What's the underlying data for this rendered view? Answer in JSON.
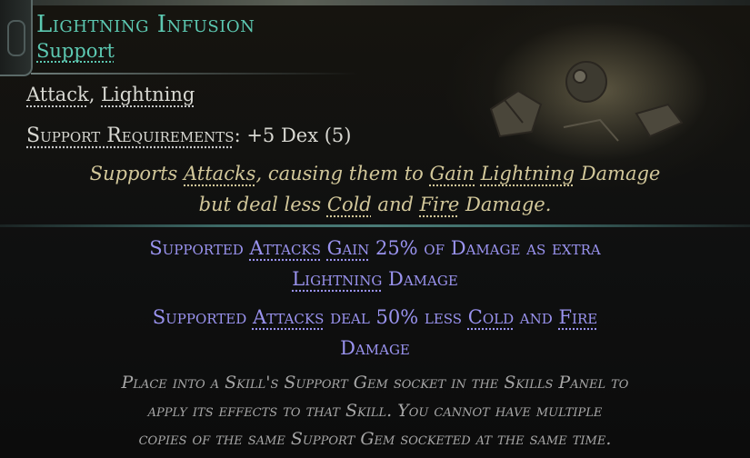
{
  "gem": {
    "name": "Lightning Infusion",
    "type": "Support",
    "tags": {
      "attack": "Attack",
      "sep": ", ",
      "lightning": "Lightning"
    },
    "requirements": {
      "label": "Support Requirements",
      "colon": ":",
      "value": "+5 Dex (5)"
    },
    "description": {
      "line1": {
        "t1": "Supports ",
        "attacks": "Attacks",
        "t2": ", causing them to ",
        "gain": "Gain",
        "t3": " ",
        "lightning": "Lightning",
        "t4": " Damage"
      },
      "line2": {
        "t1": "but deal less ",
        "cold": "Cold",
        "t2": " and ",
        "fire": "Fire",
        "t3": " Damage."
      }
    },
    "modifiers": {
      "mod1": {
        "t1": "Supported ",
        "attacks": "Attacks",
        "t2": " ",
        "gain": "Gain",
        "t3": " 25% of Damage as extra",
        "lightning": "Lightning",
        "t4": " Damage"
      },
      "mod2": {
        "t1": "Supported ",
        "attacks": "Attacks",
        "t2": " deal 50% less ",
        "cold": "Cold",
        "t3": " and ",
        "fire": "Fire",
        "t4": "Damage"
      }
    },
    "flavour": {
      "line1": "Place into a Skill's Support Gem socket in the Skills Panel to",
      "line2": "apply its effects to that Skill. You cannot have multiple",
      "line3": "copies of the same Support Gem socketed at the same time."
    }
  },
  "colors": {
    "title": "#5cc8b1",
    "description": "#d2c79a",
    "modifier": "#9a93ef",
    "flavour": "#a7a7a7",
    "text": "#d8d8d2"
  }
}
